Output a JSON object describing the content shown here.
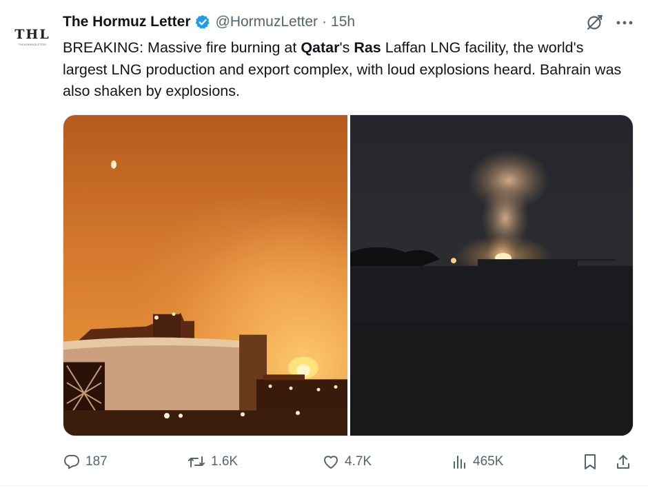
{
  "author": {
    "avatar_monogram": "THL",
    "avatar_subtext": "THEHORMUZLETTER",
    "name": "The Hormuz Letter",
    "handle": "@HormuzLetter",
    "separator": "·",
    "time": "15h",
    "verified": true
  },
  "tweet": {
    "text_1": "BREAKING: Massive fire burning at ",
    "bold_1": "Qatar",
    "text_2": "'s ",
    "bold_2": "Ras",
    "text_3": " Laffan LNG facility, the world's largest LNG production and export complex, with loud explosions heard. Bahrain was also shaken by explosions."
  },
  "media": [
    {
      "name": "photo-ras-laffan-fire",
      "description_icon": "photo"
    },
    {
      "name": "photo-night-explosion",
      "description_icon": "photo"
    }
  ],
  "actions": {
    "replies": "187",
    "reposts": "1.6K",
    "likes": "4.7K",
    "views": "465K"
  },
  "colors": {
    "text": "#0f1419",
    "muted": "#536471",
    "verified": "#1d9bf0"
  },
  "icons": [
    "verified-badge-icon",
    "grok-icon",
    "more-icon",
    "reply-icon",
    "repost-icon",
    "like-icon",
    "views-icon",
    "bookmark-icon",
    "share-icon"
  ]
}
